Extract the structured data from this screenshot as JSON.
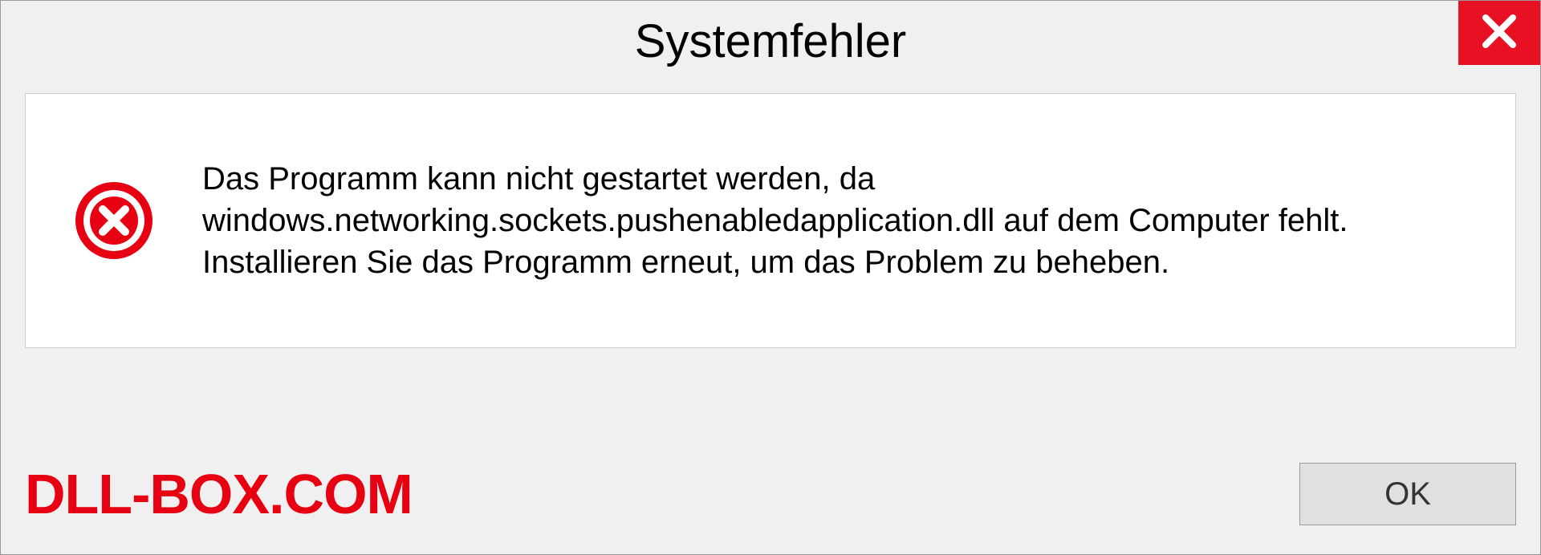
{
  "dialog": {
    "title": "Systemfehler",
    "message": "Das Programm kann nicht gestartet werden, da windows.networking.sockets.pushenabledapplication.dll auf dem Computer fehlt. Installieren Sie das Programm erneut, um das Problem zu beheben.",
    "ok_label": "OK"
  },
  "watermark": "DLL-BOX.COM",
  "icons": {
    "close": "close-icon",
    "error": "error-icon"
  },
  "colors": {
    "close_bg": "#e81123",
    "error_icon": "#e60012",
    "watermark": "#e60012"
  }
}
